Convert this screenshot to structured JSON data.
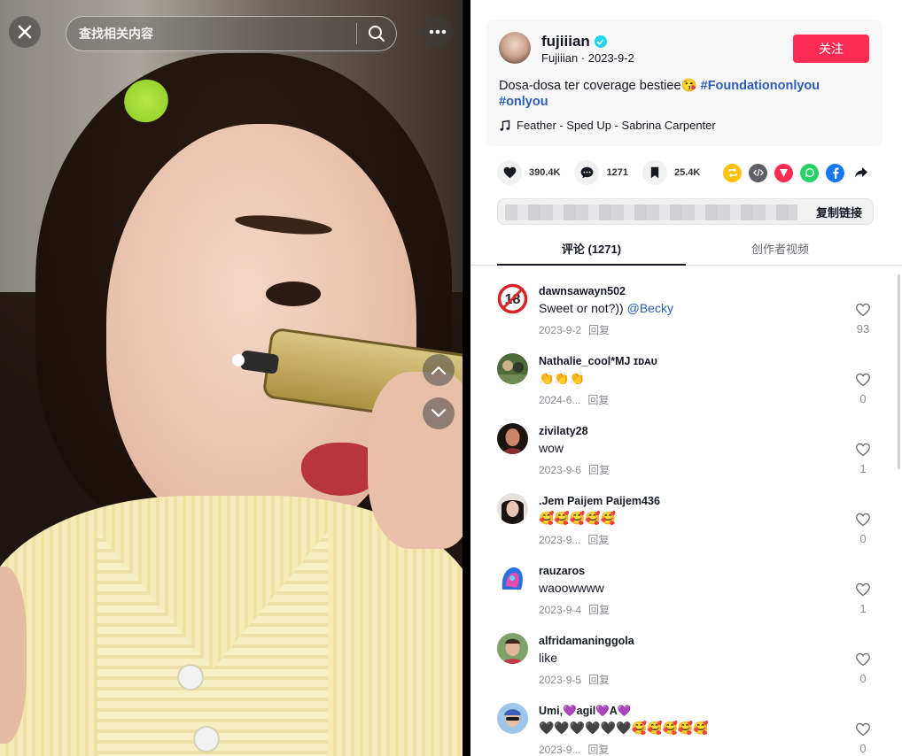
{
  "search": {
    "placeholder": "查找相关内容"
  },
  "author": {
    "name": "fujiiian",
    "handle": "Fujiiian",
    "date": "2023-9-2",
    "follow_label": "关注",
    "description_text": "Dosa-dosa ter coverage bestiee😘 ",
    "hashtags": [
      "#Foundationonlyou",
      "#onlyou"
    ],
    "music": "Feather - Sped Up - Sabrina Carpenter"
  },
  "stats": {
    "likes": "390.4K",
    "comments": "1271",
    "favorites": "25.4K"
  },
  "share_icons": [
    {
      "name": "repost-icon",
      "color": "#ffc20e"
    },
    {
      "name": "embed-icon",
      "color": "#5f5f66"
    },
    {
      "name": "send-icon",
      "color": "#fe2c55"
    },
    {
      "name": "whatsapp-icon",
      "color": "#25d366"
    },
    {
      "name": "facebook-icon",
      "color": "#1877f2"
    },
    {
      "name": "share-arrow-icon",
      "color": "#161823"
    }
  ],
  "link": {
    "copy_label": "复制链接"
  },
  "tabs": {
    "comments": "评论 (1271)",
    "videos": "创作者视频"
  },
  "reply_label": "回复",
  "comments": [
    {
      "user": "dawnsawayn502",
      "text": "Sweet or not?)) ",
      "mention": "@Becky",
      "date": "2023-9-2",
      "likes": "93"
    },
    {
      "user": "Nathalie_cool*MJ ɪᴅᴀᴜ",
      "text": "👏👏👏",
      "mention": "",
      "date": "2024-6...",
      "likes": "0"
    },
    {
      "user": "zivilaty28",
      "text": "wow",
      "mention": "",
      "date": "2023-9-6",
      "likes": "1"
    },
    {
      "user": ".Jem Paijem Paijem436",
      "text": "🥰🥰🥰🥰🥰",
      "mention": "",
      "date": "2023-9...",
      "likes": "0"
    },
    {
      "user": "rauzaros",
      "text": "waoowwww",
      "mention": "",
      "date": "2023-9-4",
      "likes": "1"
    },
    {
      "user": "alfridamaninggola",
      "text": "like",
      "mention": "",
      "date": "2023-9-5",
      "likes": "0"
    },
    {
      "user": "Umi,💜agil💜A💜",
      "text": "🖤🖤🖤🖤🖤🖤🥰🥰🥰🥰🥰",
      "mention": "",
      "date": "2023-9...",
      "likes": "0"
    }
  ],
  "colors": {
    "accent": "#fe2c55",
    "link": "#2b5db9",
    "verified": "#20d5ec"
  }
}
